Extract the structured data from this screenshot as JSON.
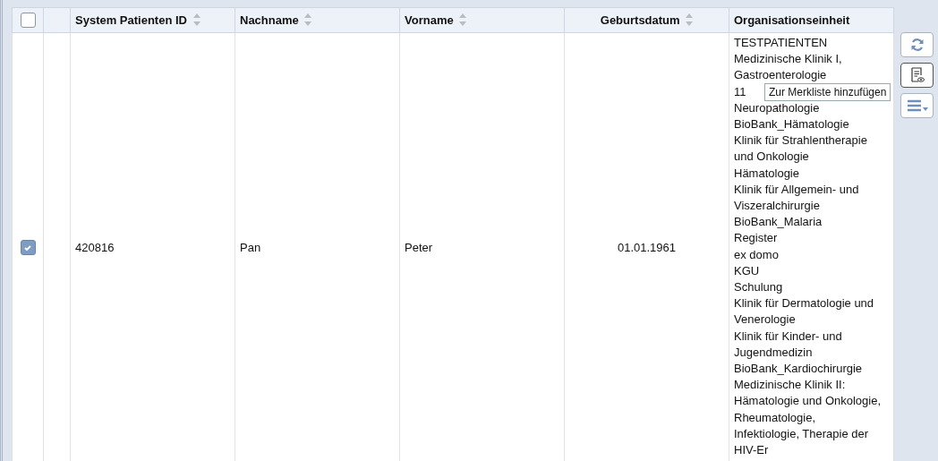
{
  "table": {
    "header_checkbox": {
      "checked": false
    },
    "columns": [
      {
        "label": "System Patienten ID",
        "sortable": true
      },
      {
        "label": "Nachname",
        "sortable": true
      },
      {
        "label": "Vorname",
        "sortable": true
      },
      {
        "label": "Geburtsdatum",
        "sortable": true
      },
      {
        "label": "Organisationseinheit",
        "sortable": false
      }
    ],
    "rows": [
      {
        "checked": true,
        "cells": [
          "420816",
          "Pan",
          "Peter",
          "01.01.1961"
        ],
        "org_units": [
          "TESTPATIENTEN",
          "Medizinische Klinik I, Gastroenterologie",
          "11",
          "Neuropathologie",
          "BioBank_Hämatologie",
          "Klinik für Strahlentherapie und Onkologie",
          "Hämatologie",
          "Klinik für Allgemein- und Viszeralchirurgie",
          "BioBank_Malaria",
          "Register",
          "ex domo",
          "KGU",
          "Schulung",
          "Klinik für Dermatologie und Venerologie",
          "Klinik für Kinder- und Jugendmedizin",
          "BioBank_Kardiochirurgie",
          "Medizinische Klinik II: Hämatologie und Onkologie, Rheumatologie, Infektiologie, Therapie der HIV-Er"
        ]
      }
    ]
  },
  "toolbar": [
    {
      "kind": "refresh"
    },
    {
      "kind": "watchlist"
    },
    {
      "kind": "menu"
    }
  ],
  "tooltip": {
    "text": "Zur Merkliste hinzufügen"
  }
}
